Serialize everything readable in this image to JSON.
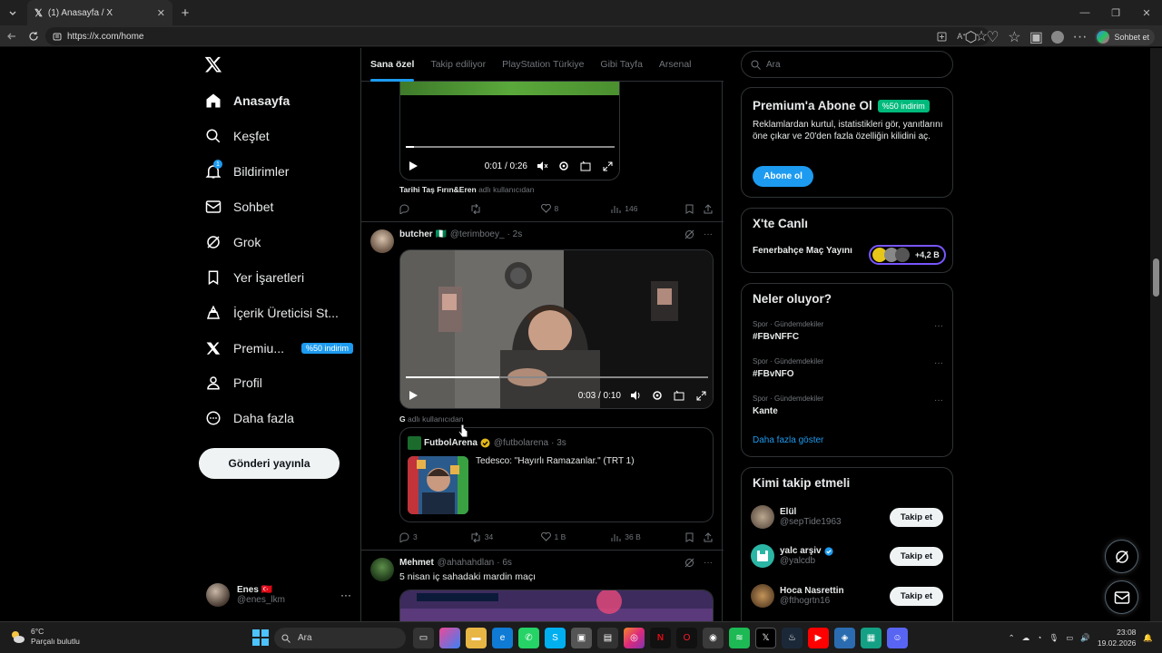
{
  "browser": {
    "tab_title": "(1) Anasayfa / X",
    "url": "https://x.com/home",
    "copilot_label": "Sohbet et"
  },
  "sidebar": {
    "items": [
      {
        "label": "Anasayfa",
        "icon": "home-icon"
      },
      {
        "label": "Keşfet",
        "icon": "search-icon"
      },
      {
        "label": "Bildirimler",
        "icon": "bell-icon",
        "badge": "1"
      },
      {
        "label": "Sohbet",
        "icon": "mail-icon"
      },
      {
        "label": "Grok",
        "icon": "grok-icon"
      },
      {
        "label": "Yer İşaretleri",
        "icon": "bookmark-icon"
      },
      {
        "label": "İçerik Üreticisi St...",
        "icon": "creator-studio-icon"
      },
      {
        "label": "Premiu...",
        "icon": "x-premium-icon",
        "pill": "%50 indirim"
      },
      {
        "label": "Profil",
        "icon": "person-icon"
      },
      {
        "label": "Daha fazla",
        "icon": "more-circle-icon"
      }
    ],
    "post_button": "Gönderi yayınla",
    "account": {
      "name": "Enes 🇹🇷",
      "handle": "@enes_lkm"
    }
  },
  "timeline": {
    "tabs": [
      "Sana özel",
      "Takip ediliyor",
      "PlayStation Türkiye",
      "Gibi Tayfa",
      "Arsenal"
    ],
    "active_tab": "Sana özel",
    "tweet1": {
      "video_time": "0:01 / 0:26",
      "video_progress": 0.04,
      "source_user": "Tarihi Taş Fırın&Eren",
      "source_suffix": "adlı kullanıcıdan",
      "replies": "",
      "retweets": "",
      "likes": "8",
      "views": "146"
    },
    "tweet2": {
      "name": "butcher 🇳🇬",
      "handle": "@terimboey_",
      "time": "· 2s",
      "video_time": "0:03 / 0:10",
      "video_progress": 0.31,
      "source_user": "G",
      "source_suffix": "adlı kullanıcıdan",
      "quote": {
        "name": "FutbolArena",
        "handle": "@futbolarena",
        "time": "· 3s",
        "text": "Tedesco: \"Hayırlı Ramazanlar.\" (TRT 1)"
      },
      "replies": "3",
      "retweets": "34",
      "likes": "1 B",
      "views": "36 B"
    },
    "tweet3": {
      "name": "Mehmet",
      "handle": "@ahahahdlan",
      "time": "· 6s",
      "text": "5 nisan iç sahadaki mardin maçı"
    }
  },
  "right": {
    "search_placeholder": "Ara",
    "premium": {
      "title": "Premium'a Abone Ol",
      "pill": "%50 indirim",
      "text": "Reklamlardan kurtul, istatistikleri gör, yanıtlarını öne çıkar ve 20'den fazla özelliğin kilidini aç.",
      "button": "Abone ol"
    },
    "live": {
      "title": "X'te Canlı",
      "item": "Fenerbahçe Maç Yayını",
      "count": "+4,2 B"
    },
    "trends": {
      "title": "Neler oluyor?",
      "items": [
        {
          "category": "Spor · Gündemdekiler",
          "name": "#FBvNFFC"
        },
        {
          "category": "Spor · Gündemdekiler",
          "name": "#FBvNFO"
        },
        {
          "category": "Spor · Gündemdekiler",
          "name": "Kante"
        }
      ],
      "more": "Daha fazla göster"
    },
    "who_to_follow": {
      "title": "Kimi takip etmeli",
      "follow_label": "Takip et",
      "items": [
        {
          "name": "Elül",
          "handle": "@sepTide1963"
        },
        {
          "name": "yalc arşiv",
          "handle": "@yalcdb",
          "verified": true
        },
        {
          "name": "Hoca Nasrettin",
          "handle": "@fthogrtn16"
        }
      ]
    }
  },
  "taskbar": {
    "temp": "6°C",
    "weather": "Parçalı bulutlu",
    "search": "Ara",
    "time": "23:08",
    "date": "19.02.2026"
  },
  "colors": {
    "accent": "#1d9bf0",
    "background": "#000000",
    "border": "#2f3336",
    "muted": "#71767b",
    "premium_green": "#00ba7c"
  }
}
